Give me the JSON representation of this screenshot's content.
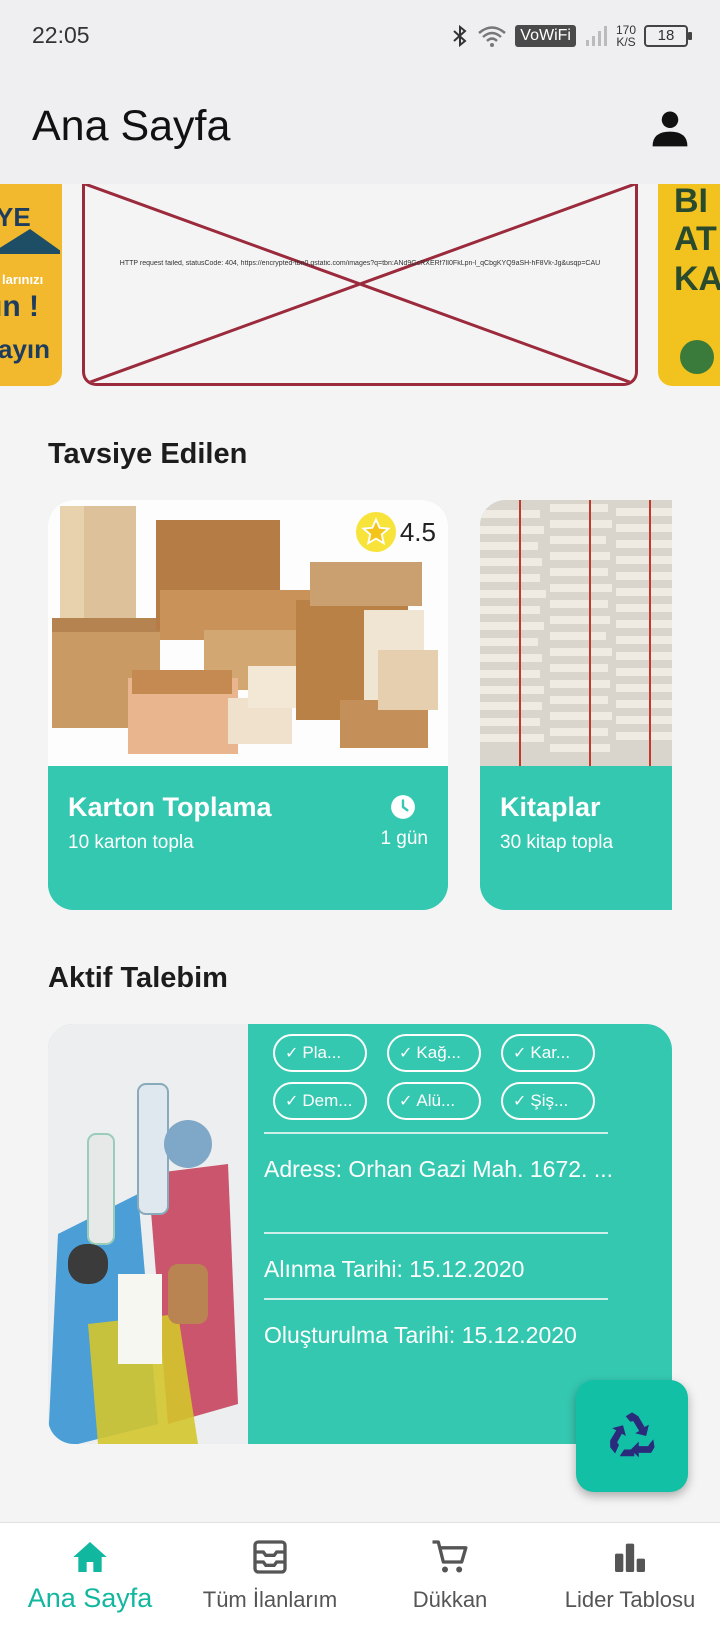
{
  "status_bar": {
    "time": "22:05",
    "network_label": "VoWiFi",
    "speed_value": "170",
    "speed_unit": "K/S",
    "battery": "18"
  },
  "app_bar": {
    "title": "Ana Sayfa",
    "profile_icon": "person-icon"
  },
  "banner": {
    "error_message": "HTTP request failed, statusCode: 404, https://encrypted-tbn0.gstatic.com/images?q=tbn:ANd9GcRXERf7lI0FkLpn-l_qCbgKYQ9aSH-hF8Vk-Jg&usqp=CAU",
    "left_text": [
      "YE",
      "larınızı",
      "ın !",
      "ayın"
    ],
    "right_text": [
      "BI",
      "AT",
      "KA"
    ]
  },
  "recommended": {
    "title": "Tavsiye Edilen",
    "cards": [
      {
        "title": "Karton Toplama",
        "subtitle": "10 karton topla",
        "duration": "1 gün",
        "rating": "4.5"
      },
      {
        "title": "Kitaplar",
        "subtitle": "30 kitap topla"
      }
    ]
  },
  "active_request": {
    "title": "Aktif Talebim",
    "chips": [
      "Pla...",
      "Kağ...",
      "Kar...",
      "Dem...",
      "Alü...",
      "Şiş..."
    ],
    "address": "Adress: Orhan Gazi Mah. 1672. ...",
    "pickup_date": "Alınma Tarihi: 15.12.2020",
    "created_date": "Oluşturulma Tarihi: 15.12.2020"
  },
  "fab": {
    "icon": "recycle-icon"
  },
  "bottom_nav": {
    "items": [
      {
        "label": "Ana Sayfa",
        "icon": "home-icon",
        "active": true
      },
      {
        "label": "Tüm İlanlarım",
        "icon": "inbox-icon",
        "active": false
      },
      {
        "label": "Dükkan",
        "icon": "cart-icon",
        "active": false
      },
      {
        "label": "Lider Tablosu",
        "icon": "leaderboard-icon",
        "active": false
      }
    ]
  },
  "colors": {
    "accent": "#35c8b1",
    "active_nav": "#12b7a0",
    "fab_icon": "#2b2b7c",
    "star": "#f7e33a"
  }
}
